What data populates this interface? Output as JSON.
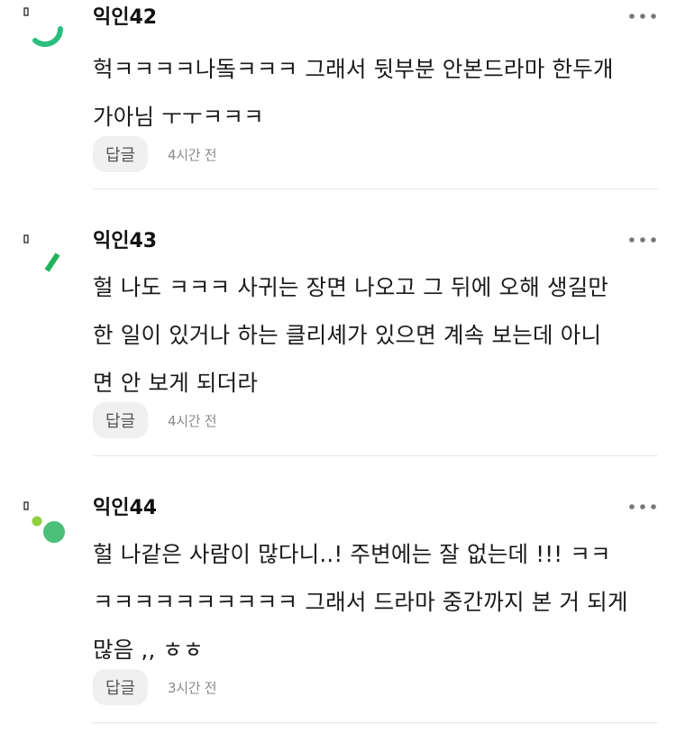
{
  "comments": [
    {
      "author": "익인42",
      "lines": [
        "헉ㅋㅋㅋㅋ나돜ㅋㅋㅋ 그래서 뒷부분 안본드라마 한두개",
        "가아님 ㅜㅜㅋㅋㅋ"
      ],
      "reply_label": "답글",
      "timestamp": "4시간 전",
      "avatar_icon": "green-arc-avatar-icon",
      "more_icon": "more-dots-icon"
    },
    {
      "author": "익인43",
      "lines": [
        "헐 나도 ㅋㅋㅋ 사귀는 장면 나오고 그 뒤에 오해 생길만",
        "한 일이 있거나 하는 클리셰가 있으면 계속 보는데 아니",
        "면 안 보게 되더라"
      ],
      "reply_label": "답글",
      "timestamp": "4시간 전",
      "avatar_icon": "green-slash-avatar-icon",
      "more_icon": "more-dots-icon"
    },
    {
      "author": "익인44",
      "lines": [
        "헐 나같은 사람이 많다니..! 주변에는 잘 없는데 !!! ㅋㅋ",
        "ㅋㅋㅋㅋㅋㅋㅋㅋㅋㅋ 그래서 드라마 중간까지 본 거 되게",
        "많음 ,, ㅎㅎ"
      ],
      "reply_label": "답글",
      "timestamp": "3시간 전",
      "avatar_icon": "green-dots-avatar-icon",
      "more_icon": "more-dots-icon"
    }
  ],
  "colors": {
    "accent_green": "#2bbf7f",
    "accent_green_dark": "#21b35a",
    "accent_lime": "#8fd13f",
    "reply_bg": "#f0f0f0",
    "divider": "#e6e6e6",
    "meta_text": "#8a8a8a"
  }
}
